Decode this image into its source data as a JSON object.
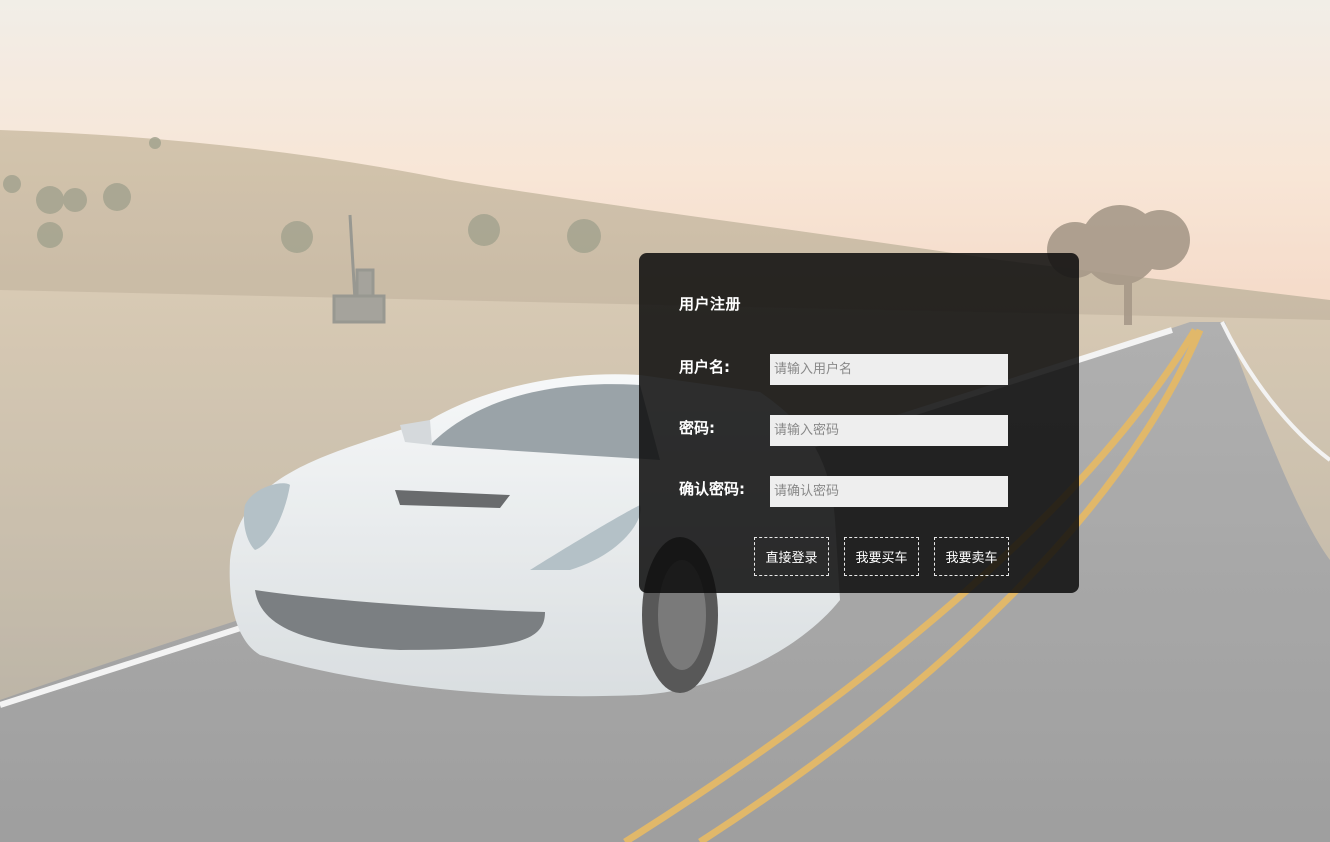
{
  "form": {
    "title": "用户注册",
    "fields": [
      {
        "label": "用户名:",
        "placeholder": "请输入用户名",
        "value": ""
      },
      {
        "label": "密码:",
        "placeholder": "请输入密码",
        "value": ""
      },
      {
        "label": "确认密码:",
        "placeholder": "请确认密码",
        "value": ""
      }
    ],
    "buttons": {
      "login": "直接登录",
      "buy": "我要买车",
      "sell": "我要卖车"
    }
  },
  "colors": {
    "panel_bg": "#0c0c0c",
    "input_bg": "#eeeeee",
    "text": "#ffffff",
    "road_line": "#d9a441"
  },
  "background": {
    "description_icon": "car-road-photo"
  }
}
